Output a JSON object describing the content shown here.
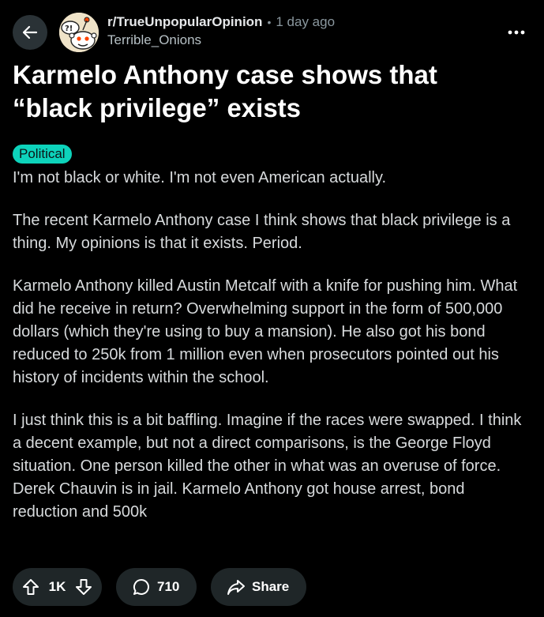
{
  "header": {
    "subreddit": "r/TrueUnpopularOpinion",
    "separator": "•",
    "age": "1 day ago",
    "author": "Terrible_Onions"
  },
  "post": {
    "title": "Karmelo Anthony case shows that “black privilege” exists",
    "flair": "Political",
    "paragraphs": [
      "I'm not black or white. I'm not even American actually.",
      "The recent Karmelo Anthony case I think shows that black privilege is a thing. My opinions is that it exists. Period.",
      "Karmelo Anthony killed Austin Metcalf with a knife for pushing him. What did he receive in return? Overwhelming support in the form of 500,000 dollars (which they're using to buy a mansion). He also got his bond reduced to 250k from 1 million even when prosecutors pointed out his history of incidents within the school.",
      "I just think this is a bit baffling. Imagine if the races were swapped. I think a decent example, but not a direct comparisons, is the George Floyd situation. One person killed the other in what was an overuse of force. Derek Chauvin is in jail. Karmelo Anthony got house arrest, bond reduction and 500k"
    ]
  },
  "actions": {
    "votes": "1K",
    "comments": "710",
    "share": "Share"
  },
  "icons": {
    "back": "back-arrow-icon",
    "more": "more-options-icon",
    "upvote": "upvote-arrow-icon",
    "downvote": "downvote-arrow-icon",
    "comment": "comment-bubble-icon",
    "share": "share-arrow-icon"
  },
  "colors": {
    "background": "#000000",
    "flair": "#0dd3bb",
    "pill": "#1f2628",
    "back_button": "#2a3236",
    "muted_text": "#8a979e"
  }
}
